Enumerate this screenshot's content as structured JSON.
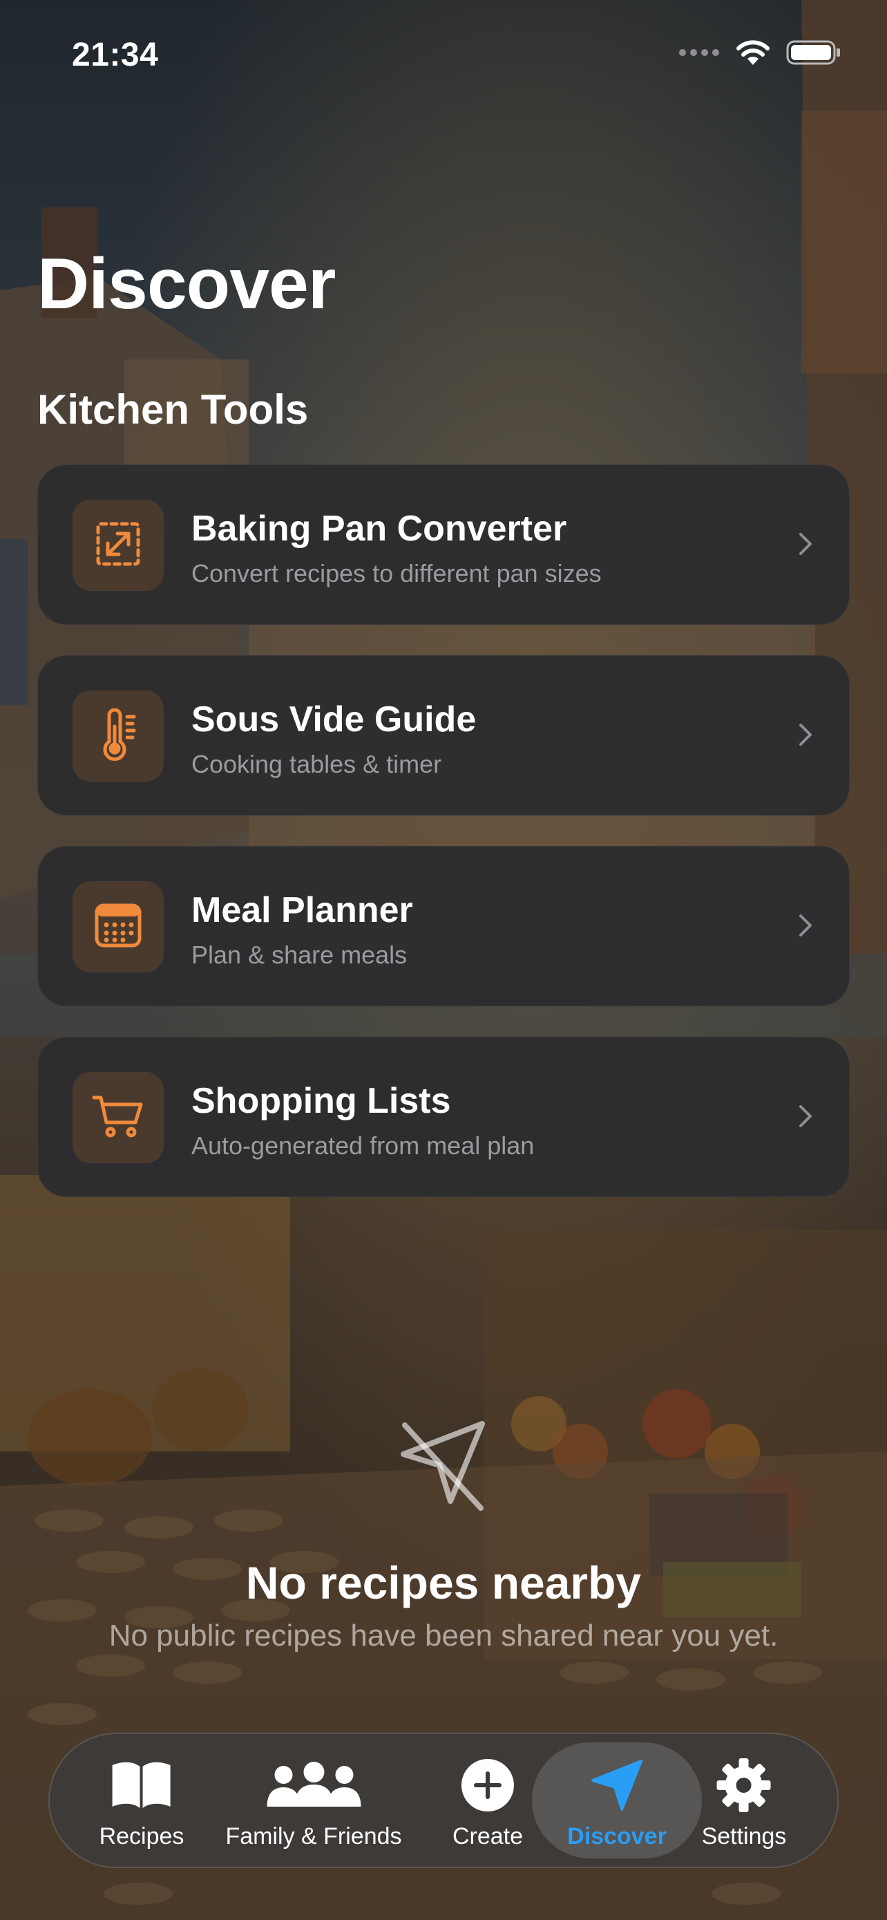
{
  "status_bar": {
    "time": "21:34"
  },
  "page": {
    "title": "Discover"
  },
  "section": {
    "title": "Kitchen Tools"
  },
  "accent_color": "#f08a3c",
  "active_tab_color": "#2a9df4",
  "tools": [
    {
      "title": "Baking Pan Converter",
      "subtitle": "Convert recipes to different pan sizes",
      "icon": "resize-arrow-icon"
    },
    {
      "title": "Sous Vide Guide",
      "subtitle": "Cooking tables & timer",
      "icon": "thermometer-icon"
    },
    {
      "title": "Meal Planner",
      "subtitle": "Plan & share meals",
      "icon": "calendar-icon"
    },
    {
      "title": "Shopping Lists",
      "subtitle": "Auto-generated from meal plan",
      "icon": "cart-icon"
    }
  ],
  "empty_state": {
    "title": "No recipes nearby",
    "message": "No public recipes have been shared near you yet.",
    "icon": "location-slash-icon"
  },
  "tab_bar": {
    "tabs": [
      {
        "label": "Recipes",
        "icon": "book-icon"
      },
      {
        "label": "Family & Friends",
        "icon": "people-icon"
      },
      {
        "label": "Create",
        "icon": "plus-circle-icon"
      },
      {
        "label": "Discover",
        "icon": "location-arrow-icon",
        "active": true
      },
      {
        "label": "Settings",
        "icon": "gear-icon"
      }
    ]
  }
}
